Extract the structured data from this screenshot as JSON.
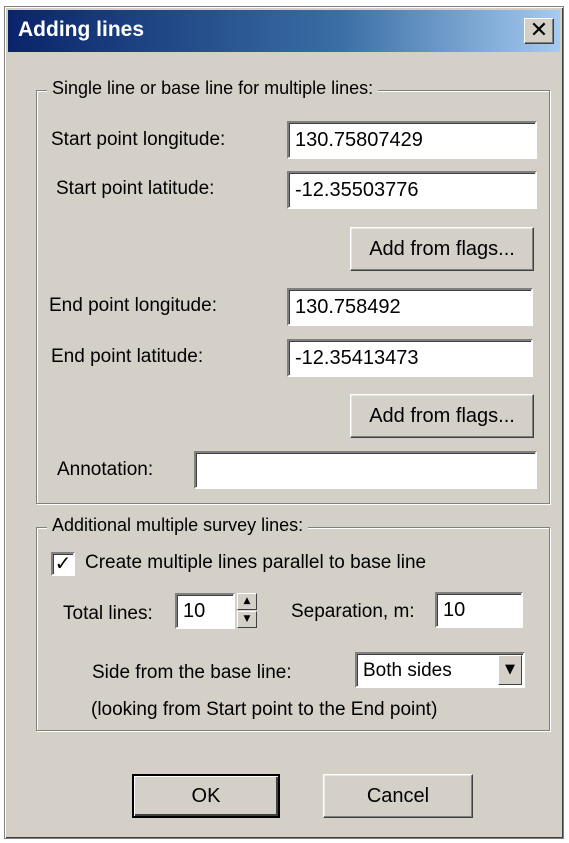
{
  "window": {
    "title": "Adding lines",
    "close_glyph": "✕"
  },
  "single_group": {
    "legend": "Single line or base line for multiple lines:",
    "start_longitude_label": "Start point longitude:",
    "start_longitude_value": "130.75807429",
    "start_latitude_label": "Start point latitude:",
    "start_latitude_value": "-12.35503776",
    "add_from_flags_1": "Add from flags...",
    "end_longitude_label": "End point longitude:",
    "end_longitude_value": "130.758492",
    "end_latitude_label": "End point latitude:",
    "end_latitude_value": "-12.35413473",
    "add_from_flags_2": "Add from flags...",
    "annotation_label": "Annotation:",
    "annotation_value": ""
  },
  "multi_group": {
    "legend": "Additional multiple survey lines:",
    "create_multiple_label": "Create multiple lines parallel to base line",
    "create_multiple_checked": true,
    "check_glyph": "✓",
    "total_lines_label": "Total lines:",
    "total_lines_value": "10",
    "spin_up": "▲",
    "spin_down": "▼",
    "separation_label": "Separation, m:",
    "separation_value": "10",
    "side_label": "Side from the base line:",
    "side_value": "Both sides",
    "side_arrow": "▼",
    "note": "(looking from Start point to the End point)"
  },
  "footer": {
    "ok_label": "OK",
    "cancel_label": "Cancel"
  }
}
